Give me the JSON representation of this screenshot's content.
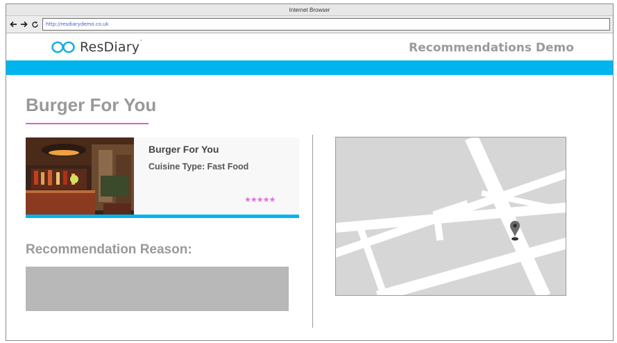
{
  "browser": {
    "title": "Internet Browser",
    "url": "http://resdiarydemo.co.uk"
  },
  "header": {
    "logo_text": "ResDiary",
    "logo_tm": "™",
    "demo_title": "Recommendations Demo"
  },
  "page": {
    "title": "Burger For You"
  },
  "restaurant": {
    "name": "Burger For You",
    "cuisine_label": "Cuisine Type:",
    "cuisine_value": "Fast Food",
    "stars": "★★★★★",
    "rating": 5,
    "max_rating": 5
  },
  "recommendation": {
    "heading": "Recommendation Reason:"
  },
  "colors": {
    "accent": "#00b5ee",
    "underline": "#e05ad8",
    "stars": "#e46ae6",
    "map_bg": "#d6d6d6",
    "reason_box": "#b8b8b8"
  },
  "icons": {
    "back": "arrow-left-icon",
    "forward": "arrow-right-icon",
    "reload": "reload-icon",
    "map_pin": "map-pin-icon"
  }
}
